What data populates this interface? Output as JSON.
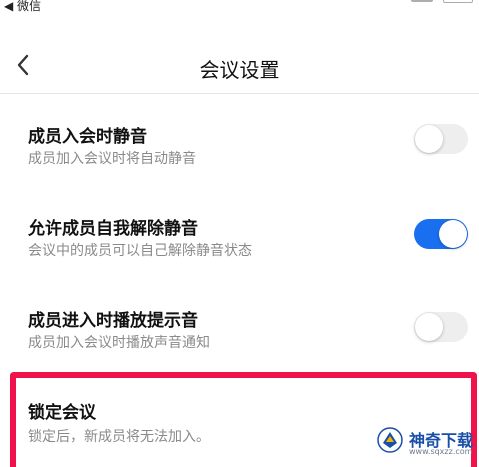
{
  "status_bar": {
    "back_label": "◀ 微信"
  },
  "header": {
    "title": "会议设置"
  },
  "settings": [
    {
      "title": "成员入会时静音",
      "desc": "成员加入会议时将自动静音",
      "on": false
    },
    {
      "title": "允许成员自我解除静音",
      "desc": "会议中的成员可以自己解除静音状态",
      "on": true
    },
    {
      "title": "成员进入时播放提示音",
      "desc": "成员加入会议时播放声音通知",
      "on": false
    },
    {
      "title": "锁定会议",
      "desc": "锁定后，新成员将无法加入。"
    }
  ],
  "watermark": {
    "name": "神奇下载",
    "url": "www.sqxzz.com"
  },
  "colors": {
    "toggle_on": "#1a6ef0",
    "toggle_off": "#eeeeee",
    "highlight": "#f0134b",
    "watermark": "#1a4fa8"
  }
}
